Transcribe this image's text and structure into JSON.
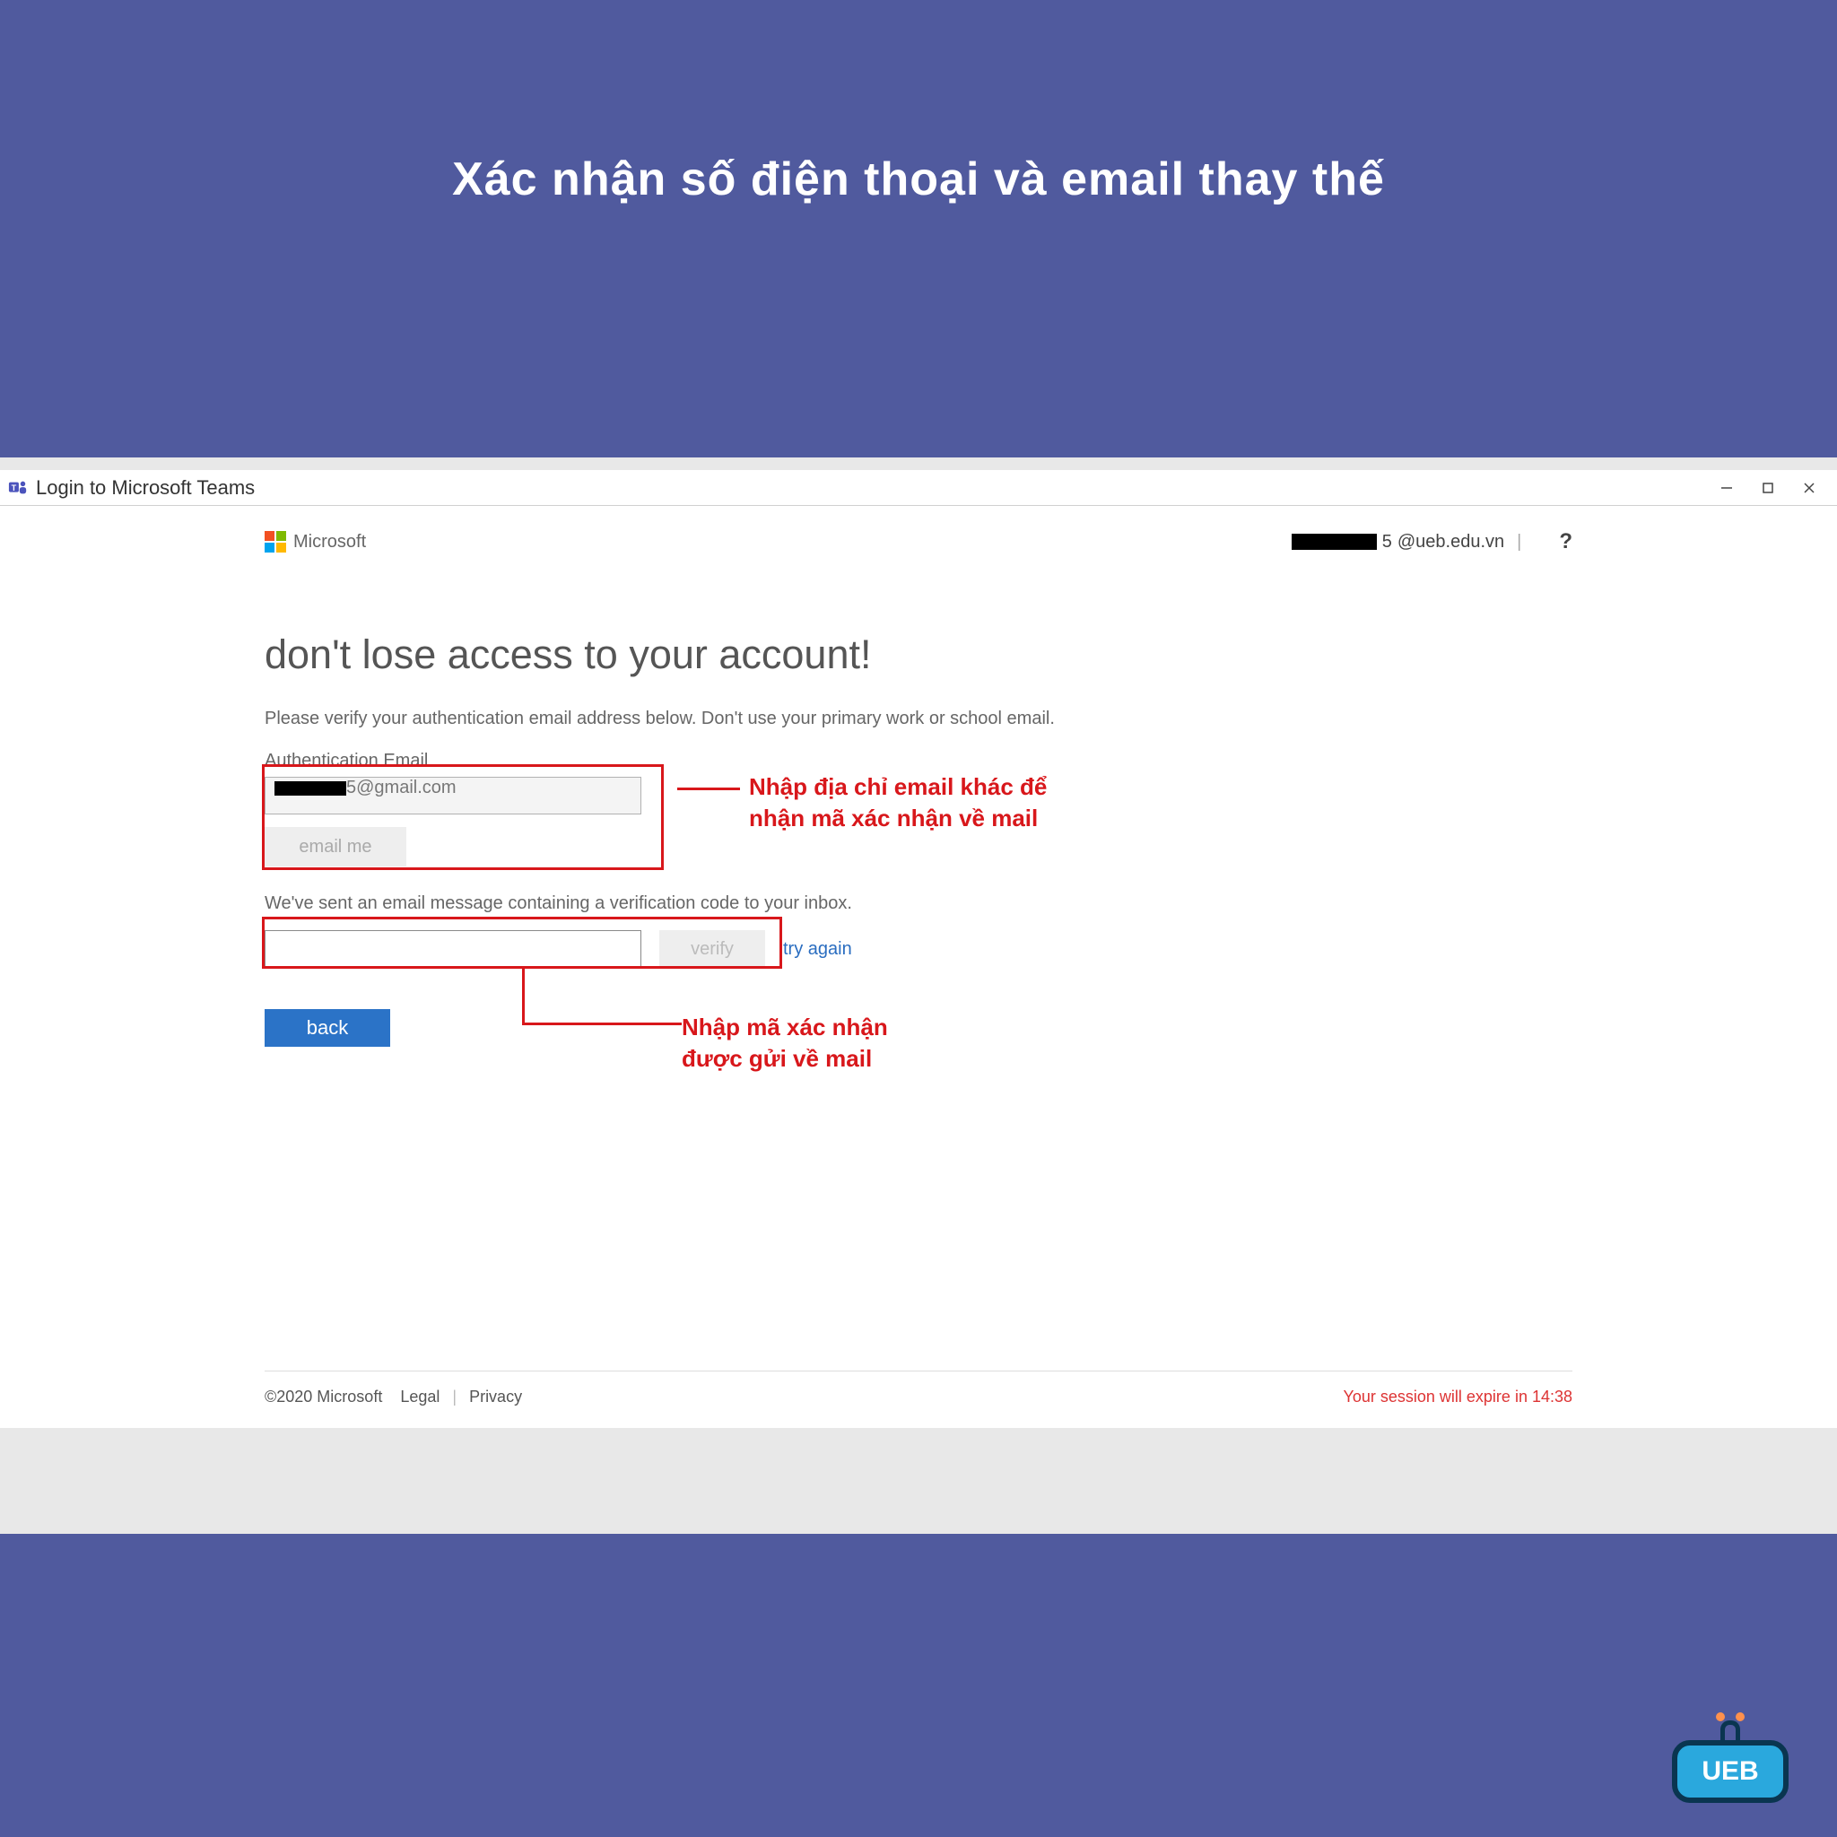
{
  "title": "Xác nhận số điện thoại và email thay thế",
  "window": {
    "title": "Login to Microsoft Teams",
    "icon": "teams-icon"
  },
  "header": {
    "brand": "Microsoft",
    "user_email_suffix": "@ueb.edu.vn",
    "user_email_visible_digit": "5",
    "help": "?"
  },
  "main": {
    "headline": "don't lose access to your account!",
    "instruction": "Please verify your authentication email address below. Don't use your primary work or school email.",
    "auth_label": "Authentication Email",
    "auth_value_suffix": "@gmail.com",
    "auth_value_visible_digit": "5",
    "email_me_btn": "email me",
    "sent_msg": "We've sent an email message containing a verification code to your inbox.",
    "verify_btn": "verify",
    "try_again": "try again",
    "back_btn": "back"
  },
  "footer": {
    "copyright": "©2020 Microsoft",
    "legal": "Legal",
    "divider": "|",
    "privacy": "Privacy",
    "session": "Your session will expire in 14:38"
  },
  "callouts": {
    "c1_l1": "Nhập địa chỉ email khác để",
    "c1_l2": "nhận mã xác nhận về mail",
    "c2_l1": "Nhập mã xác nhận",
    "c2_l2": "được gửi về mail"
  },
  "badge": "UEB"
}
